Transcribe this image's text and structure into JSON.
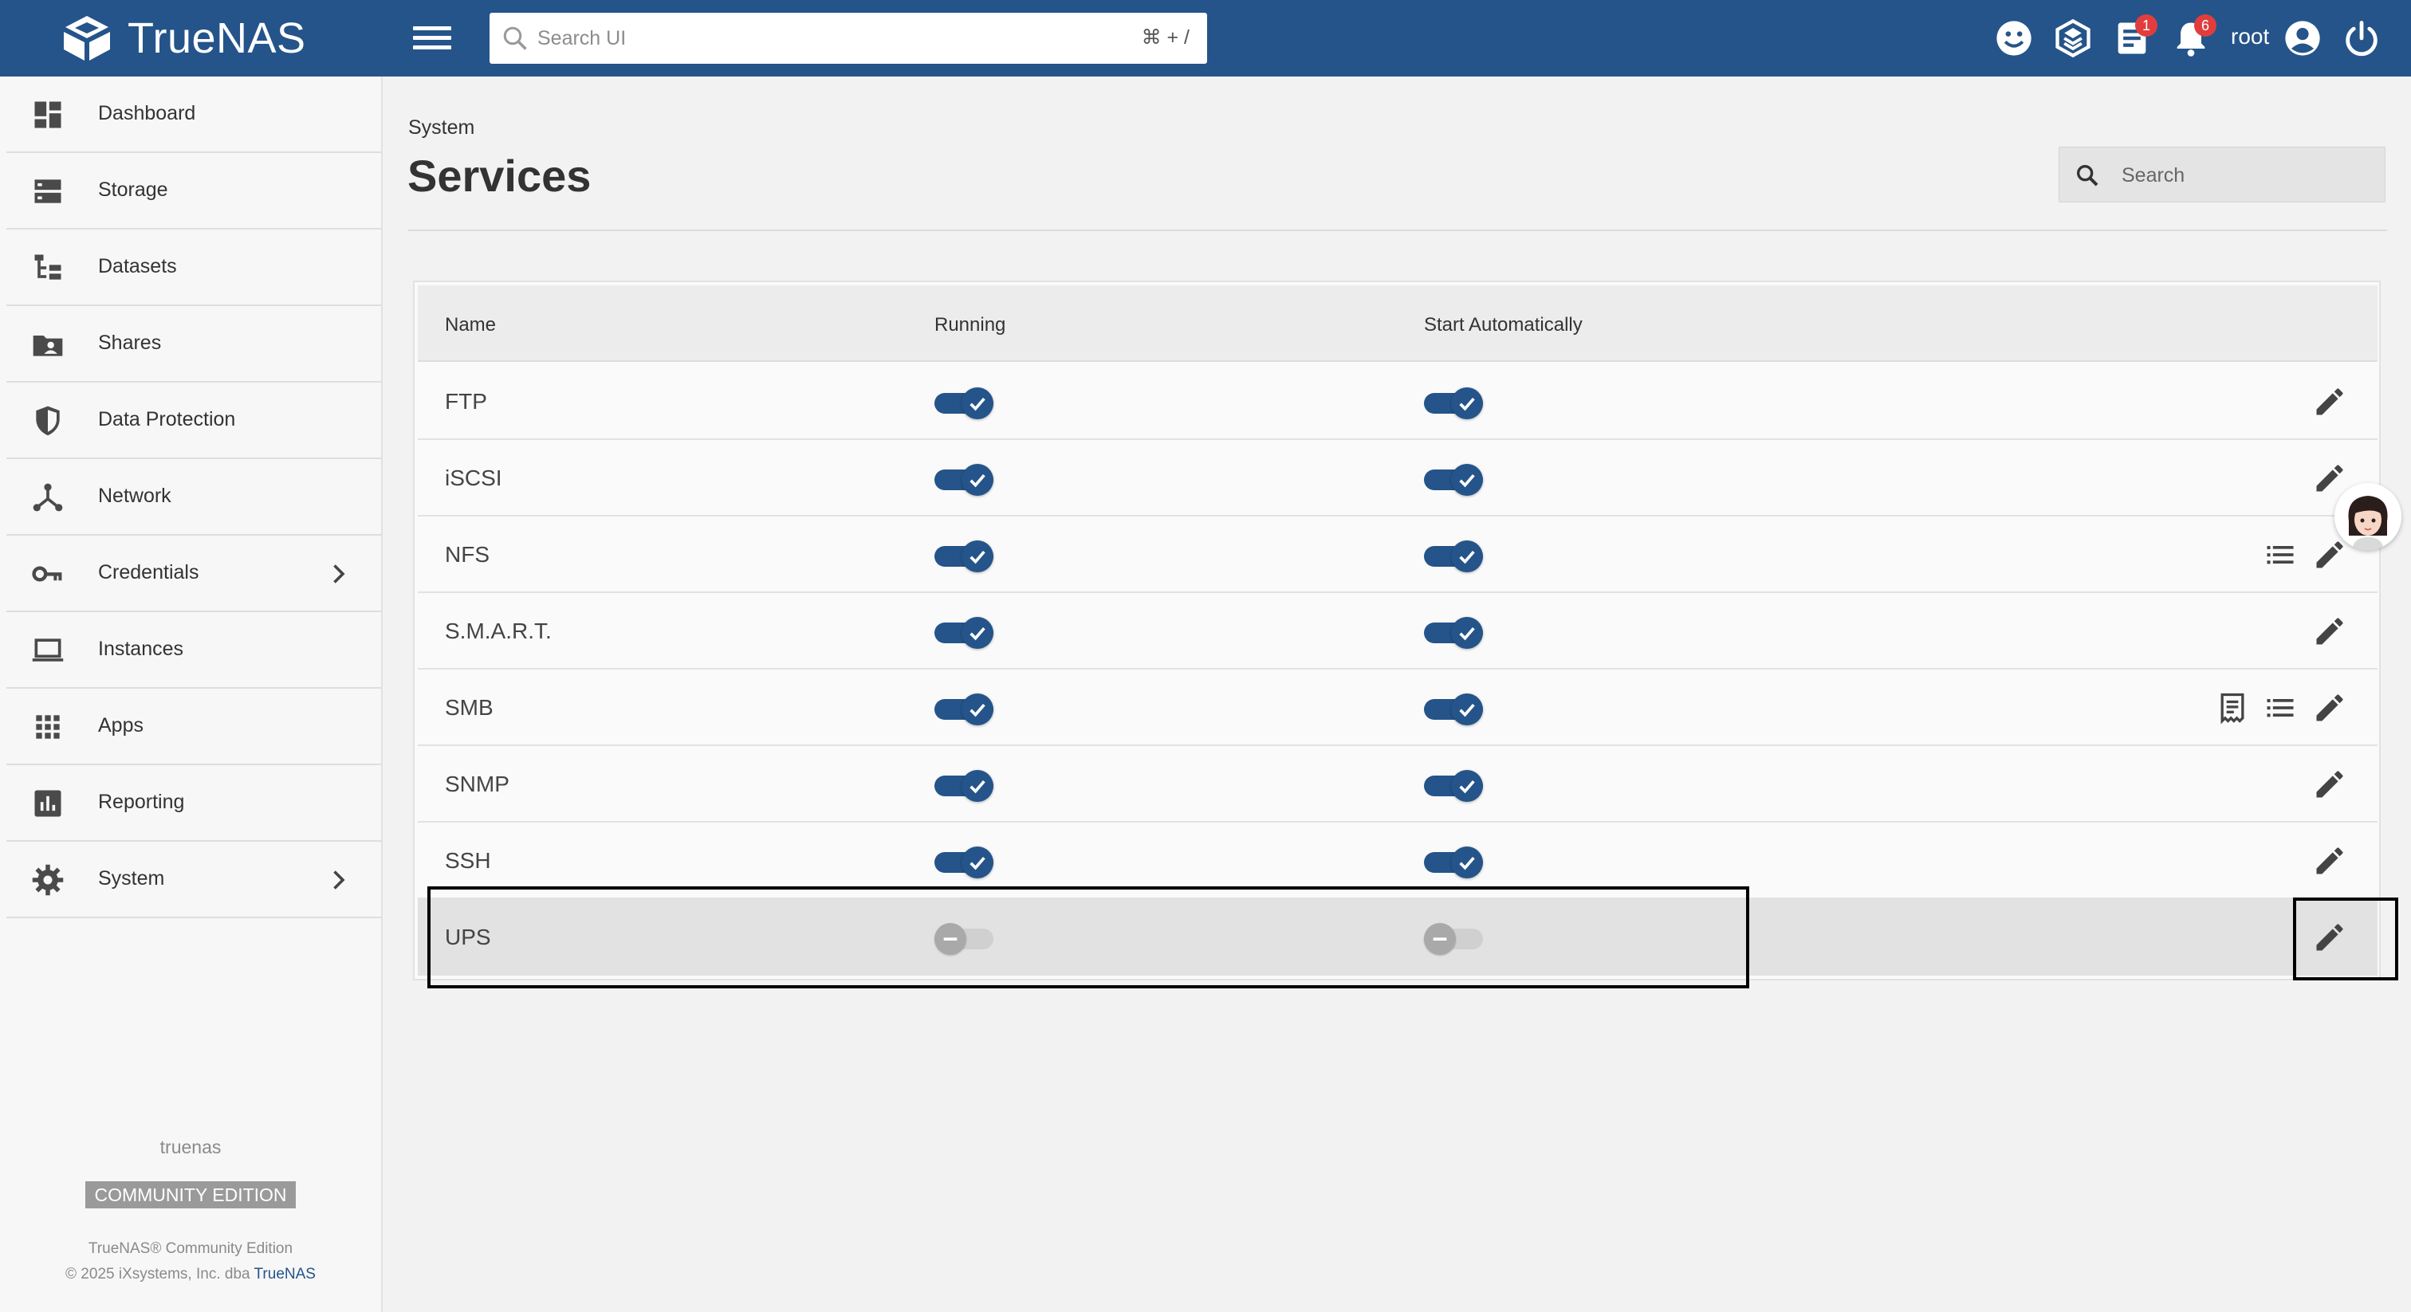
{
  "app": {
    "logo_text": "TrueNAS",
    "brand_color": "#24548a"
  },
  "topbar": {
    "search_placeholder": "Search UI",
    "search_shortcut": "⌘ + /",
    "icons": [
      "feedback-icon",
      "truecommand-icon",
      "jobs-icon",
      "alerts-icon",
      "account-icon",
      "power-icon"
    ],
    "jobs_badge": "1",
    "alerts_badge": "6",
    "username": "root"
  },
  "sidebar": {
    "items": [
      {
        "label": "Dashboard",
        "icon": "dashboard-icon"
      },
      {
        "label": "Storage",
        "icon": "storage-icon"
      },
      {
        "label": "Datasets",
        "icon": "datasets-icon"
      },
      {
        "label": "Shares",
        "icon": "shares-icon"
      },
      {
        "label": "Data Protection",
        "icon": "shield-icon"
      },
      {
        "label": "Network",
        "icon": "network-icon"
      },
      {
        "label": "Credentials",
        "icon": "key-icon"
      },
      {
        "label": "Instances",
        "icon": "laptop-icon"
      },
      {
        "label": "Apps",
        "icon": "apps-grid-icon"
      },
      {
        "label": "Reporting",
        "icon": "reporting-icon"
      },
      {
        "label": "System",
        "icon": "gear-icon"
      }
    ],
    "hostname": "truenas",
    "edition": "COMMUNITY EDITION",
    "copyright_line1": "TrueNAS® Community Edition",
    "copyright_line2_prefix": "© 2025 iXsystems, Inc. dba ",
    "copyright_link": "TrueNAS"
  },
  "page": {
    "breadcrumb": "System",
    "title": "Services",
    "search_placeholder": "Search"
  },
  "table": {
    "columns": {
      "name": "Name",
      "running": "Running",
      "start_automatically": "Start Automatically"
    },
    "rows": [
      {
        "name": "FTP",
        "running": true,
        "start_automatically": true
      },
      {
        "name": "iSCSI",
        "running": true,
        "start_automatically": true
      },
      {
        "name": "NFS",
        "running": true,
        "start_automatically": true
      },
      {
        "name": "S.M.A.R.T.",
        "running": true,
        "start_automatically": true
      },
      {
        "name": "SMB",
        "running": true,
        "start_automatically": true
      },
      {
        "name": "SNMP",
        "running": true,
        "start_automatically": true
      },
      {
        "name": "SSH",
        "running": true,
        "start_automatically": true
      },
      {
        "name": "UPS",
        "running": false,
        "start_automatically": false
      }
    ]
  }
}
